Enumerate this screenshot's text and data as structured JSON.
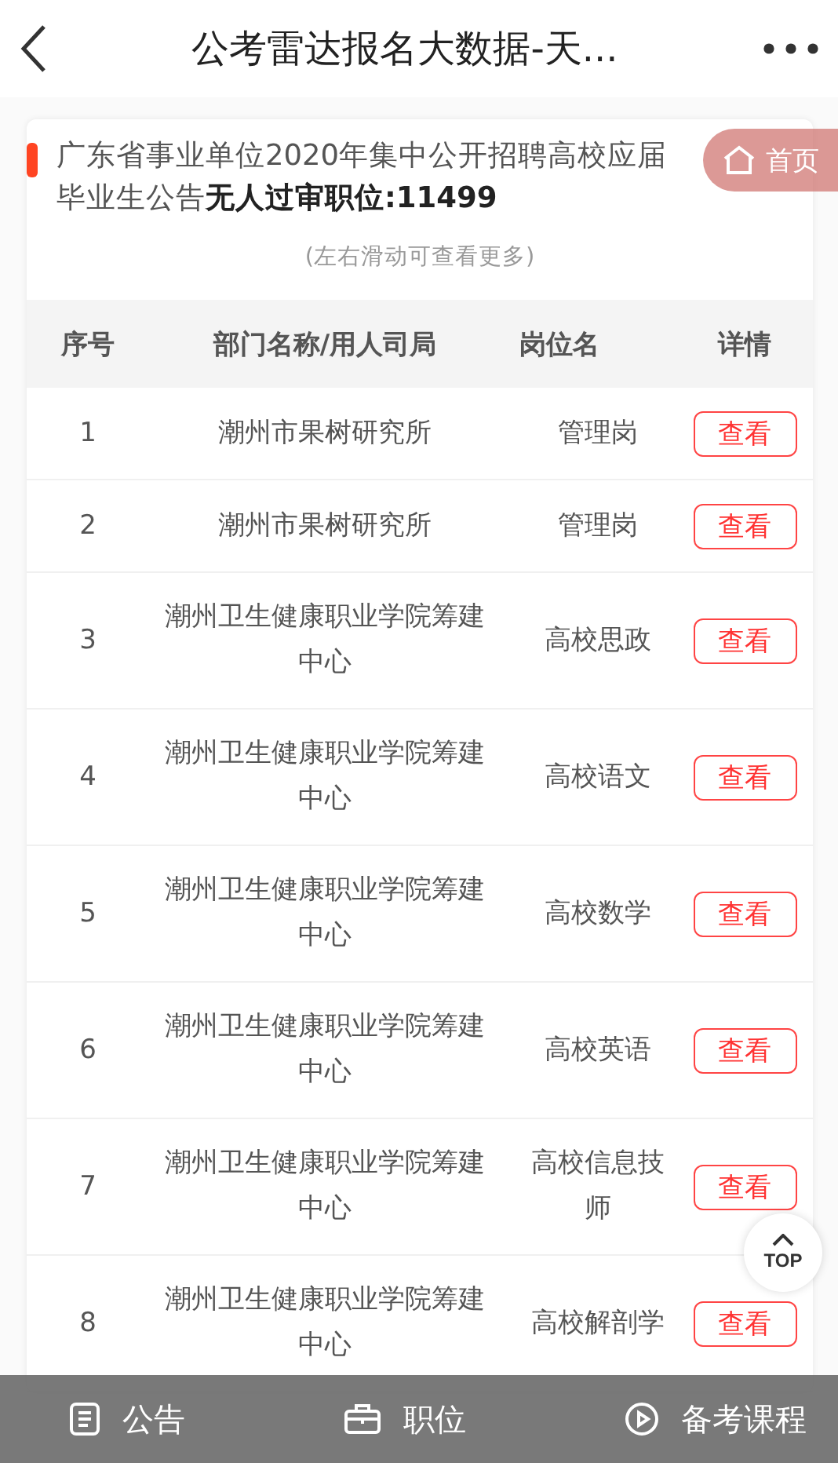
{
  "header": {
    "title": "公考雷达报名大数据-天..."
  },
  "card": {
    "title": "广东省事业单位2020年集中公开招聘高校应届毕业生公告**无人过审职位:11499**",
    "hint": "(左右滑动可查看更多)"
  },
  "home_button": {
    "label": "首页"
  },
  "table": {
    "columns": [
      "序号",
      "部门名称/用人司局",
      "岗位名",
      "详情"
    ],
    "rows": [
      {
        "index": "1",
        "department": "潮州市果树研究所",
        "position": [
          "管理岗"
        ],
        "action": "查看"
      },
      {
        "index": "2",
        "department": "潮州市果树研究所",
        "position": [
          "管理岗"
        ],
        "action": "查看"
      },
      {
        "index": "3",
        "department": "潮州卫生健康职业学院筹建中心",
        "position": [
          "高校思政"
        ],
        "action": "查看"
      },
      {
        "index": "4",
        "department": "潮州卫生健康职业学院筹建中心",
        "position": [
          "高校语文"
        ],
        "action": "查看"
      },
      {
        "index": "5",
        "department": "潮州卫生健康职业学院筹建中心",
        "position": [
          "高校数学"
        ],
        "action": "查看"
      },
      {
        "index": "6",
        "department": "潮州卫生健康职业学院筹建中心",
        "position": [
          "高校英语"
        ],
        "action": "查看"
      },
      {
        "index": "7",
        "department": "潮州卫生健康职业学院筹建中心",
        "position": [
          "高校信息技",
          "师"
        ],
        "action": "查看"
      },
      {
        "index": "8",
        "department": "潮州卫生健康职业学院筹建中心",
        "position": [
          "高校解剖学"
        ],
        "action": "查看"
      }
    ]
  },
  "top_button": {
    "label": "TOP"
  },
  "bottom_nav": [
    {
      "kind": "notice",
      "label": "公告"
    },
    {
      "kind": "jobs",
      "label": "职位"
    },
    {
      "kind": "course",
      "label": "备考课程"
    }
  ]
}
